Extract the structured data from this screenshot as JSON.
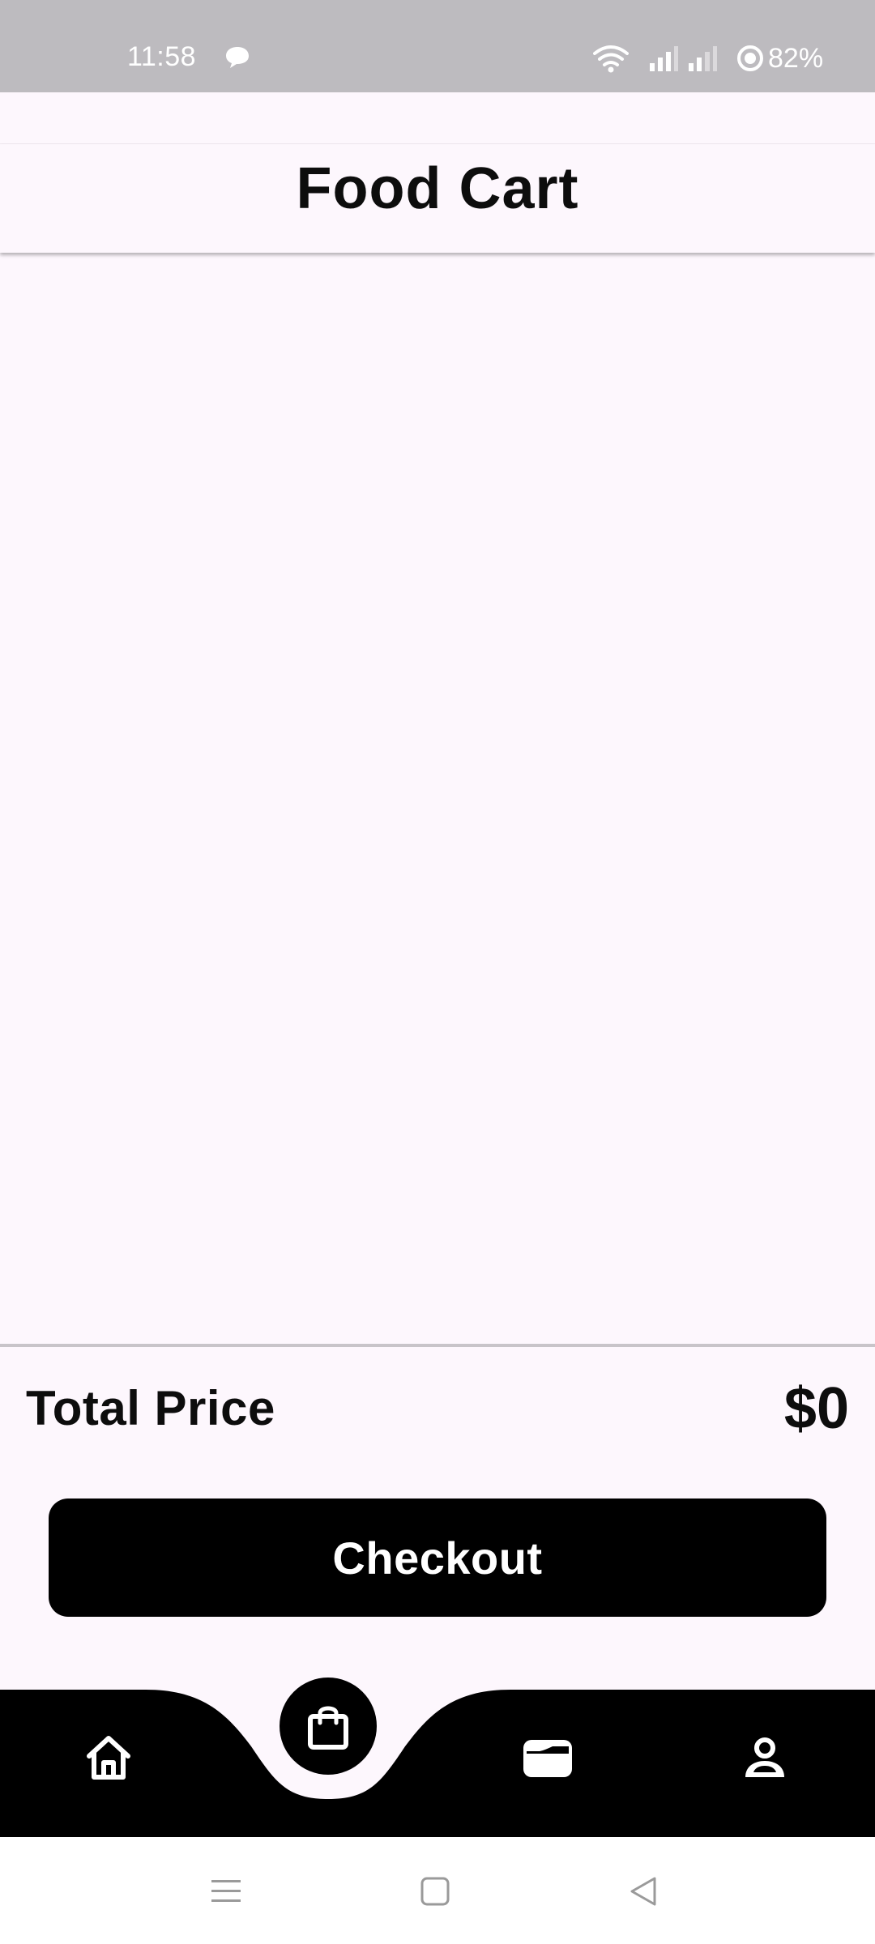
{
  "status_bar": {
    "time": "11:58",
    "battery": "82%",
    "icons": [
      "message-icon",
      "wifi-icon",
      "signal-icon",
      "signal-icon",
      "data-saver-icon"
    ]
  },
  "header": {
    "title": "Food Cart"
  },
  "cart": {
    "items": []
  },
  "summary": {
    "total_label": "Total Price",
    "total_value": "$0",
    "checkout_label": "Checkout"
  },
  "bottom_nav": {
    "items": [
      {
        "icon": "home-icon",
        "active": false
      },
      {
        "icon": "shopping-bag-icon",
        "active": true
      },
      {
        "icon": "wallet-icon",
        "active": false
      },
      {
        "icon": "profile-icon",
        "active": false
      }
    ]
  },
  "system_nav": {
    "buttons": [
      "recents-icon",
      "home-square-icon",
      "back-icon"
    ]
  },
  "colors": {
    "background": "#fdf7fd",
    "status_bar": "#bdbbbf",
    "primary": "#000000",
    "on_primary": "#ffffff"
  }
}
